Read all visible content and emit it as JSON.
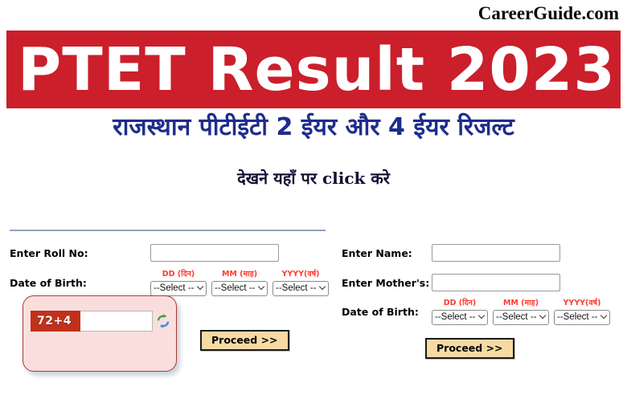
{
  "brand": {
    "name": "CareerGuide.com"
  },
  "banner": {
    "title": "PTET Result 2023",
    "bg_color": "#CB1F2B"
  },
  "headings": {
    "hindi_main": "राजस्थान पीटीईटी 2 ईयर और 4 ईयर रिजल्ट",
    "hindi_main_color": "#1E2C8C",
    "hindi_sub": "देखने यहाँ पर click करे"
  },
  "form_left": {
    "roll_label": "Enter Roll No:",
    "roll_value": "",
    "roll_placeholder": "",
    "dob_label": "Date of Birth:",
    "dob": {
      "day_caption": "DD (दिन)",
      "month_caption": "MM (माह)",
      "year_caption": "YYYY(वर्ष)",
      "day_value": "--Select --",
      "month_value": "--Select --",
      "year_value": "--Select --",
      "caption_color": "#FF3B30"
    },
    "captcha": {
      "code": "72+4",
      "input_value": "",
      "input_placeholder": "",
      "refresh_icon": "refresh-icon",
      "code_bg": "#C0301A",
      "panel_bg": "#FADEDE"
    },
    "proceed_label": "Proceed >>"
  },
  "form_right": {
    "name_label": "Enter Name:",
    "name_value": "",
    "name_placeholder": "",
    "mother_label": "Enter Mother's:",
    "mother_value": "",
    "mother_placeholder": "",
    "dob_label": "Date of Birth:",
    "dob": {
      "day_caption": "DD (दिन)",
      "month_caption": "MM (माह)",
      "year_caption": "YYYY(वर्ष)",
      "day_value": "--Select --",
      "month_value": "--Select --",
      "year_value": "--Select --"
    },
    "proceed_label": "Proceed >>"
  }
}
